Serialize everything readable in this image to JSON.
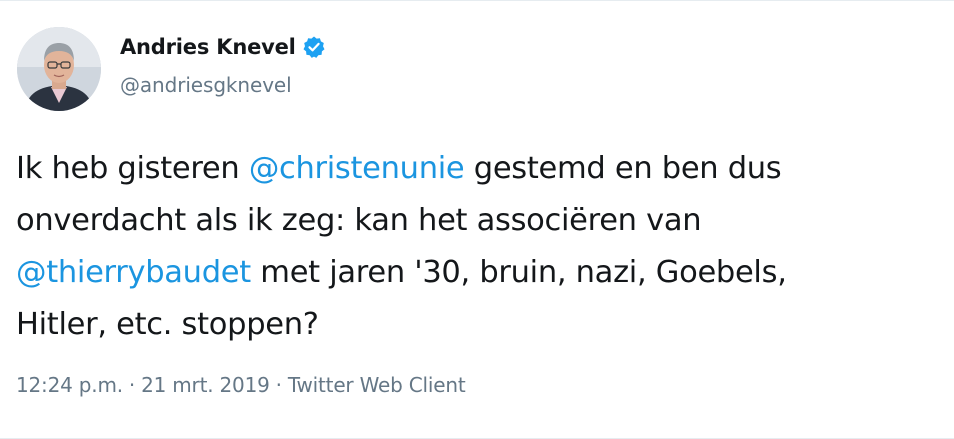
{
  "tweet": {
    "author": {
      "display_name": "Andries Knevel",
      "handle": "@andriesgknevel",
      "verified_icon": "verified-badge-icon",
      "avatar_icon": "profile-photo"
    },
    "text": {
      "line1_pre": "Ik heb gisteren ",
      "mention1": "@christenunie",
      "line1_post": " gestemd en ben dus",
      "line2": "onverdacht als ik zeg: kan het associëren van",
      "mention2": "@thierrybaudet",
      "line3_post": " met jaren '30, bruin, nazi, Goebels,",
      "line4": "Hitler, etc. stoppen?"
    },
    "meta": {
      "time": "12:24 p.m.",
      "separator": "·",
      "date": "21 mrt. 2019",
      "client": "Twitter Web Client"
    }
  },
  "colors": {
    "text": "#14171a",
    "secondary": "#657786",
    "link": "#1b95e0",
    "verified": "#1da1f2"
  }
}
